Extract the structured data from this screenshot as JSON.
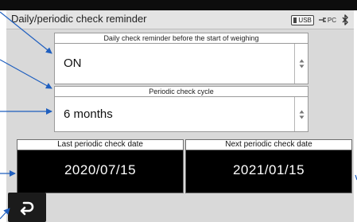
{
  "window": {
    "title": "Daily/periodic check reminder",
    "status": {
      "usb_label": "USB",
      "pc_label": "PC"
    }
  },
  "daily_check": {
    "label": "Daily check reminder before the start of weighing",
    "value": "ON"
  },
  "periodic_cycle": {
    "label": "Periodic check cycle",
    "value": "6 months"
  },
  "last_check": {
    "label": "Last periodic check date",
    "value": "2020/07/15"
  },
  "next_check": {
    "label": "Next periodic check date",
    "value": "2021/01/15"
  },
  "icons": {
    "back": "return-arrow-icon",
    "usb": "usb-icon",
    "pc": "pc-connection-icon",
    "bluetooth": "bluetooth-icon"
  },
  "colors": {
    "annotation_arrow": "#1f5fbf",
    "date_panel_bg": "#000000",
    "screen_bg": "#d9d9d9"
  }
}
